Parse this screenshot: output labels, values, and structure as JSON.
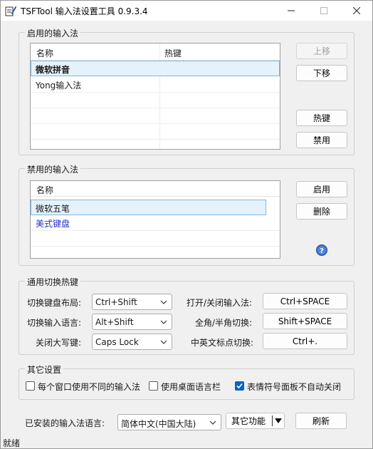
{
  "window": {
    "title": "TSFTool 输入法设置工具 0.9.3.4"
  },
  "enabled_group": {
    "title": "启用的输入法",
    "columns": [
      "名称",
      "热键"
    ],
    "rows": [
      {
        "name": "微软拼音",
        "hotkey": ""
      },
      {
        "name": "Yong输入法",
        "hotkey": ""
      }
    ],
    "buttons": {
      "move_up": "上移",
      "move_down": "下移",
      "hotkey": "热键",
      "disable": "禁用"
    }
  },
  "disabled_group": {
    "title": "禁用的输入法",
    "columns": [
      "名称"
    ],
    "rows": [
      {
        "name": "微软五笔"
      },
      {
        "name": "美式键盘"
      }
    ],
    "buttons": {
      "enable": "启用",
      "delete": "删除"
    },
    "help_icon": "help-icon"
  },
  "hotkeys_group": {
    "title": "通用切换热键",
    "switch_layout_label": "切换键盘布局:",
    "switch_layout_value": "Ctrl+Shift",
    "switch_lang_label": "切换输入语言:",
    "switch_lang_value": "Alt+Shift",
    "caps_label": "关闭大写键:",
    "caps_value": "Caps Lock",
    "toggle_ime_label": "打开/关闭输入法:",
    "toggle_ime_value": "Ctrl+SPACE",
    "fullhalf_label": "全角/半角切换:",
    "fullhalf_value": "Shift+SPACE",
    "punct_label": "中英文标点切换:",
    "punct_value": "Ctrl+."
  },
  "other_group": {
    "title": "其它设置",
    "opt1": "每个窗口使用不同的输入法",
    "opt1_checked": false,
    "opt2": "使用桌面语言栏",
    "opt2_checked": false,
    "opt3": "表情符号面板不自动关闭",
    "opt3_checked": true
  },
  "footer": {
    "lang_label": "已安装的输入法语言:",
    "lang_value": "简体中文(中国大陆)",
    "other_func": "其它功能",
    "refresh": "刷新"
  },
  "status": {
    "text": "就绪"
  },
  "colors": {
    "accent": "#0a63c4",
    "selection_bg": "#e5f1fb",
    "selection_border": "#7bb8e8",
    "link_text": "#2431c6"
  }
}
